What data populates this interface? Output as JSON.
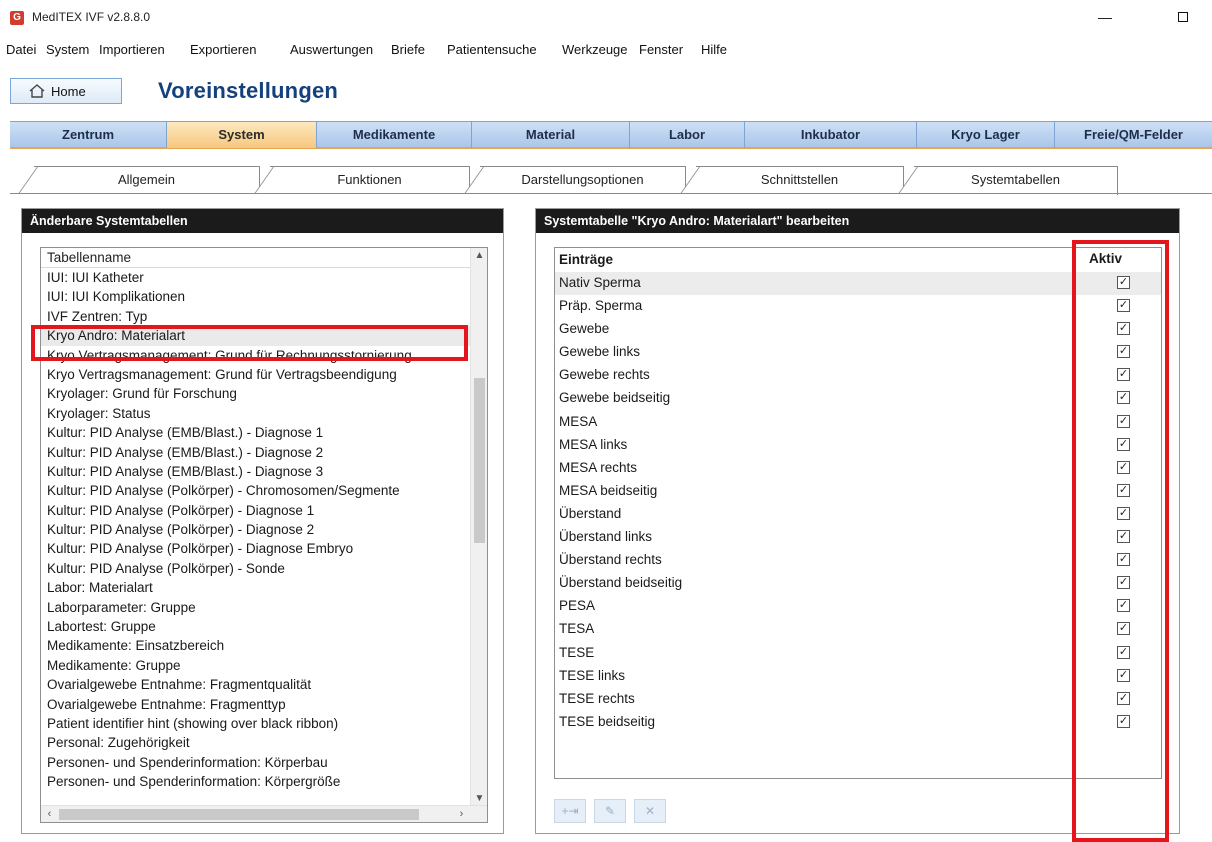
{
  "window": {
    "title": "MedITEX IVF v2.8.8.0",
    "minimize": "—",
    "maximize": "☐"
  },
  "menu": [
    "Datei",
    "System",
    "Importieren",
    "Exportieren",
    "Auswertungen",
    "Briefe",
    "Patientensuche",
    "Werkzeuge",
    "Fenster",
    "Hilfe"
  ],
  "home_label": "Home",
  "page_title": "Voreinstellungen",
  "main_tabs": [
    "Zentrum",
    "System",
    "Medikamente",
    "Material",
    "Labor",
    "Inkubator",
    "Kryo Lager",
    "Freie/QM-Felder"
  ],
  "active_main_tab": "System",
  "sub_tabs": [
    "Allgemein",
    "Funktionen",
    "Darstellungsoptionen",
    "Schnittstellen",
    "Systemtabellen"
  ],
  "active_sub_tab": "Systemtabellen",
  "left_panel": {
    "title": "Änderbare Systemtabellen",
    "column": "Tabellenname",
    "rows": [
      "IUI: IUI Katheter",
      "IUI: IUI Komplikationen",
      "IVF Zentren: Typ",
      "Kryo Andro: Materialart",
      "Kryo Vertragsmanagement: Grund für Rechnungsstornierung",
      "Kryo Vertragsmanagement: Grund für Vertragsbeendigung",
      "Kryolager: Grund für Forschung",
      "Kryolager: Status",
      "Kultur: PID Analyse (EMB/Blast.) - Diagnose 1",
      "Kultur: PID Analyse (EMB/Blast.) - Diagnose 2",
      "Kultur: PID Analyse (EMB/Blast.) - Diagnose 3",
      "Kultur: PID Analyse (Polkörper) - Chromosomen/Segmente",
      "Kultur: PID Analyse (Polkörper) - Diagnose 1",
      "Kultur: PID Analyse (Polkörper) - Diagnose 2",
      "Kultur: PID Analyse (Polkörper) - Diagnose Embryo",
      "Kultur: PID Analyse (Polkörper) - Sonde",
      "Labor: Materialart",
      "Laborparameter: Gruppe",
      "Labortest: Gruppe",
      "Medikamente: Einsatzbereich",
      "Medikamente: Gruppe",
      "Ovarialgewebe Entnahme: Fragmentqualität",
      "Ovarialgewebe Entnahme: Fragmenttyp",
      "Patient identifier hint (showing over black ribbon)",
      "Personal: Zugehörigkeit",
      "Personen- und Spenderinformation: Körperbau",
      "Personen- und Spenderinformation: Körpergröße"
    ],
    "selected_row": "Kryo Andro: Materialart"
  },
  "right_panel": {
    "title": "Systemtabelle \"Kryo Andro: Materialart\" bearbeiten",
    "col_entries": "Einträge",
    "col_active": "Aktiv",
    "rows": [
      {
        "name": "Nativ Sperma",
        "active": true
      },
      {
        "name": "Präp. Sperma",
        "active": true
      },
      {
        "name": "Gewebe",
        "active": true
      },
      {
        "name": "Gewebe links",
        "active": true
      },
      {
        "name": "Gewebe rechts",
        "active": true
      },
      {
        "name": "Gewebe beidseitig",
        "active": true
      },
      {
        "name": "MESA",
        "active": true
      },
      {
        "name": "MESA links",
        "active": true
      },
      {
        "name": "MESA rechts",
        "active": true
      },
      {
        "name": "MESA  beidseitig",
        "active": true
      },
      {
        "name": "Überstand",
        "active": true
      },
      {
        "name": "Überstand links",
        "active": true
      },
      {
        "name": "Überstand rechts",
        "active": true
      },
      {
        "name": "Überstand beidseitig",
        "active": true
      },
      {
        "name": "PESA",
        "active": true
      },
      {
        "name": "TESA",
        "active": true
      },
      {
        "name": "TESE",
        "active": true
      },
      {
        "name": "TESE links",
        "active": true
      },
      {
        "name": "TESE rechts",
        "active": true
      },
      {
        "name": "TESE beidseitig",
        "active": true
      }
    ],
    "tool_buttons": [
      "add-icon",
      "edit-icon",
      "delete-icon"
    ]
  },
  "colors": {
    "highlight": "#e3161b",
    "panel_header": "#1b1b1b",
    "title_blue": "#14417e",
    "active_tab": "#f6c77f"
  }
}
